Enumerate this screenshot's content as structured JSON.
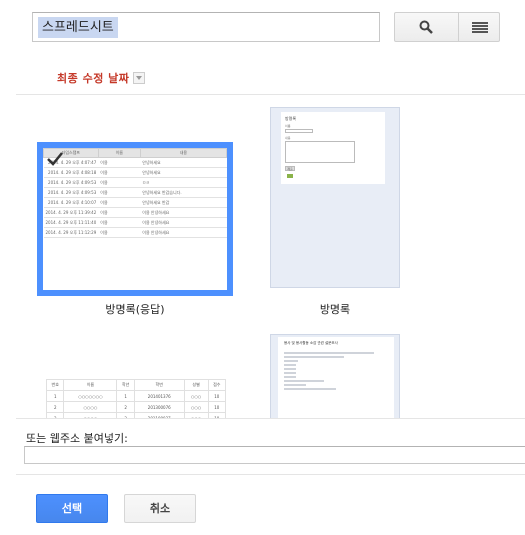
{
  "search": {
    "token": "스프레드시트",
    "placeholder": ""
  },
  "toolbar": {
    "search_icon": "search-icon",
    "view_icon": "list-view-icon"
  },
  "sort": {
    "label": "최종 수정 날짜"
  },
  "files": [
    {
      "label": "방명록(응답)",
      "selected": true,
      "preview": {
        "headers": [
          "타임스탬프",
          "이름",
          "내용"
        ],
        "rows": [
          [
            "2014. 4. 29 오후 4:07:47",
            "이용",
            "안녕하세요"
          ],
          [
            "2014. 4. 29 오후 4:08:18",
            "이용",
            "안녕하세요"
          ],
          [
            "2014. 4. 29 오후 4:09:53",
            "이용",
            "ㅁㄹ"
          ],
          [
            "2014. 4. 29 오후 4:09:53",
            "이용",
            "안녕하세요 반갑습니다."
          ],
          [
            "2014. 4. 29 오후 4:10:07",
            "이용",
            "안녕하세요 반갑"
          ],
          [
            "2014. 4. 29 오후 11:39:42",
            "이용",
            "이용 안녕하세요"
          ],
          [
            "2014. 4. 29 오후 11:11:40",
            "이용",
            "이용 안녕하세요"
          ],
          [
            "2014. 4. 29 오후 11:12:29",
            "이용",
            "이용 안녕하세요"
          ]
        ]
      }
    },
    {
      "label": "방명록",
      "selected": false,
      "preview": {
        "title": "방명록",
        "field_name": "이름",
        "field_content": "내용",
        "submit": "제출"
      }
    },
    {
      "label": "",
      "selected": false,
      "preview": {
        "headers": [
          "번호",
          "이름",
          "학년",
          "학번",
          "성별",
          "점수"
        ],
        "rows": [
          [
            "1",
            "○○○○○○○",
            "1",
            "201401376",
            "○○○",
            "10"
          ],
          [
            "2",
            "○○○○",
            "2",
            "201300076",
            "○○○",
            "10"
          ],
          [
            "3",
            "○○○○",
            "3",
            "201100037",
            "○○○",
            "10"
          ]
        ]
      }
    },
    {
      "label": "",
      "selected": false,
      "preview": {
        "title": "봉사 및 봉사활동 소감 관련 설문조사"
      }
    }
  ],
  "url": {
    "label": "또는 웹주소 붙여넣기:",
    "value": ""
  },
  "buttons": {
    "select": "선택",
    "cancel": "취소"
  },
  "colors": {
    "accent": "#4d90fe",
    "sort_label": "#c53929",
    "token_bg": "#c9d7f1"
  }
}
